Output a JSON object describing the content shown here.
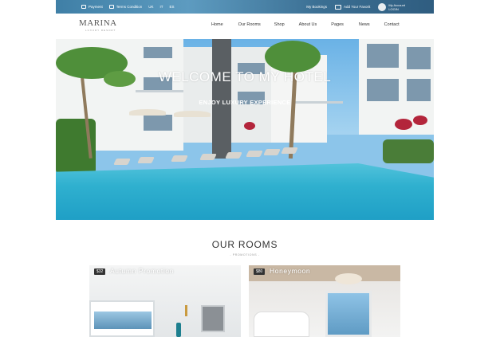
{
  "topbar": {
    "payment": "Payment",
    "terms": "Terms Condition",
    "languages": [
      "UK",
      "IT",
      "ES"
    ],
    "bookings": "My Bookings",
    "favorite": "Add Your Favorit",
    "account_line1": "My Account",
    "account_line2": "LOGIN"
  },
  "brand": {
    "name": "MARINA",
    "tagline": "LUXURY RESORT"
  },
  "nav": [
    "Home",
    "Our Rooms",
    "Shop",
    "About Us",
    "Pages",
    "News",
    "Contact"
  ],
  "hero": {
    "title": "WELCOME TO MY HOTEL",
    "subtitle": "ENJOY LUXURY EXPERIENCE"
  },
  "rooms": {
    "title": "OUR ROOMS",
    "subtitle": "- PROMOTIONS -",
    "cards": [
      {
        "price": "$32",
        "name": "Autumn Promotion"
      },
      {
        "price": "$80",
        "name": "Honeymoon"
      }
    ]
  },
  "colors": {
    "topbar": "#3f7fa6",
    "pool": "#22a3c7",
    "price_badge": "#333333"
  },
  "icons": [
    "payment-icon",
    "terms-icon",
    "mail-icon",
    "avatar-icon"
  ]
}
